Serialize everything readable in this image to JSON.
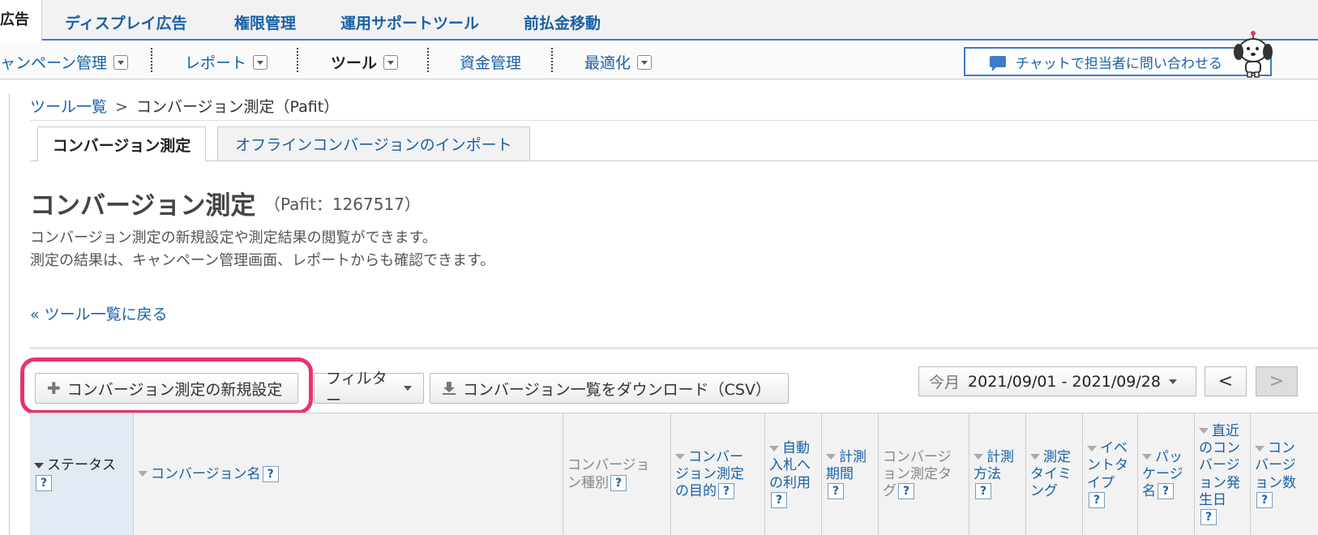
{
  "topnav": {
    "active_tab": "広告",
    "tabs": [
      "ディスプレイ広告",
      "権限管理",
      "運用サポートツール",
      "前払金移動"
    ]
  },
  "subnav": {
    "items": [
      "ャンペーン管理",
      "レポート",
      "ツール",
      "資金管理",
      "最適化"
    ]
  },
  "chat": {
    "label": "チャットで担当者に問い合わせる"
  },
  "breadcrumb": {
    "root": "ツール一覧",
    "sep": ">",
    "current": "コンバージョン測定（Pafit）"
  },
  "tabs": [
    "コンバージョン測定",
    "オフラインコンバージョンのインポート"
  ],
  "page": {
    "title": "コンバージョン測定",
    "subtitle": "（Pafit：1267517）",
    "desc1": "コンバージョン測定の新規設定や測定結果の閲覧ができます。",
    "desc2": "測定の結果は、キャンペーン管理画面、レポートからも確認できます。",
    "back": "« ツール一覧に戻る"
  },
  "toolbar": {
    "new_setting": "コンバージョン測定の新規設定",
    "filter": "フィルター",
    "download": "コンバージョン一覧をダウンロード（CSV）",
    "date_preset": "今月",
    "date_range": "2021/09/01 - 2021/09/28",
    "prev": "<",
    "next": ">"
  },
  "table": {
    "headers": [
      {
        "line1": "ステータス",
        "line2": ""
      },
      {
        "line1": "コンバージョン名",
        "line2": ""
      },
      {
        "line1": "コンバージョ",
        "line2": "ン種別"
      },
      {
        "line1": "コンバー",
        "line2": "ジョン測定",
        "line3": "の目的"
      },
      {
        "line1": "自動",
        "line2": "入札へ",
        "line3": "の利用"
      },
      {
        "line1": "計測",
        "line2": "期間"
      },
      {
        "line1": "コンバージ",
        "line2": "ョン測定タ",
        "line3": "グ"
      },
      {
        "line1": "計測",
        "line2": "方法"
      },
      {
        "line1": "測定",
        "line2": "タイミ",
        "line3": "ング"
      },
      {
        "line1": "イベ",
        "line2": "ントタ",
        "line3": "イプ"
      },
      {
        "line1": "パッ",
        "line2": "ケージ",
        "line3": "名"
      },
      {
        "line1": "直近",
        "line2": "のコン",
        "line3": "バージ",
        "line4": "ョン発",
        "line5": "生日"
      },
      {
        "line1": "コン",
        "line2": "バージ",
        "line3": "ョン数"
      }
    ],
    "help": "?"
  }
}
